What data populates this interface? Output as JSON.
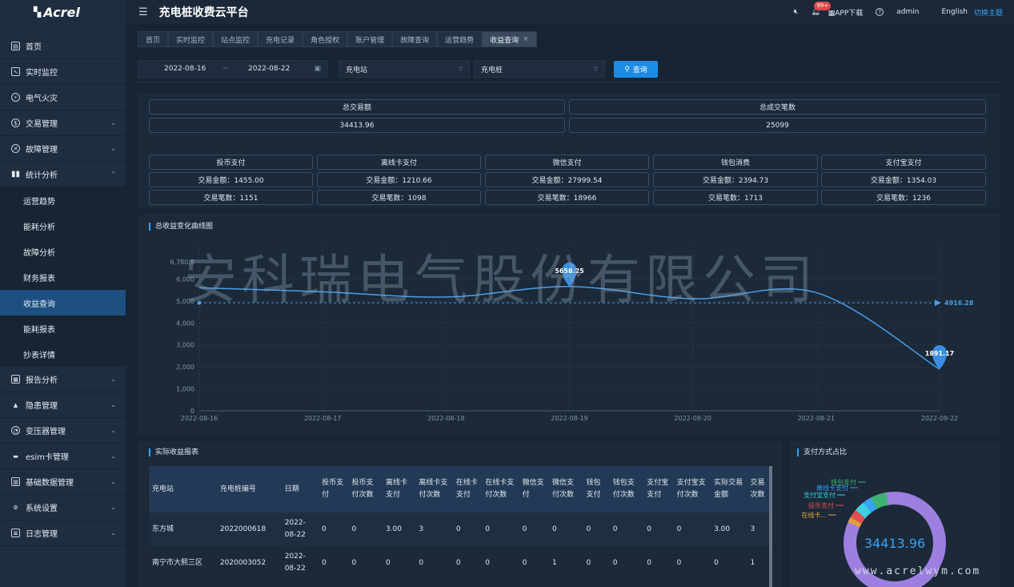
{
  "logo": {
    "text": "Acrel"
  },
  "header": {
    "title": "充电桩收费云平台",
    "badge": "99+",
    "app_download": "APP下载",
    "help": "?",
    "user": "admin",
    "language": "English",
    "theme": "切换主题"
  },
  "sidebar": {
    "items": [
      {
        "label": "首页"
      },
      {
        "label": "实时监控"
      },
      {
        "label": "电气火灾"
      },
      {
        "label": "交易管理"
      },
      {
        "label": "故障管理"
      },
      {
        "label": "统计分析"
      }
    ],
    "sub_items": [
      {
        "label": "运营趋势"
      },
      {
        "label": "能耗分析"
      },
      {
        "label": "故障分析"
      },
      {
        "label": "财务报表"
      },
      {
        "label": "收益查询"
      },
      {
        "label": "能耗报表"
      },
      {
        "label": "抄表详情"
      }
    ],
    "items_after": [
      {
        "label": "报告分析"
      },
      {
        "label": "隐患管理"
      },
      {
        "label": "变压器管理"
      },
      {
        "label": "esim卡管理"
      },
      {
        "label": "基础数据管理"
      },
      {
        "label": "系统设置"
      },
      {
        "label": "日志管理"
      }
    ]
  },
  "tabs": [
    {
      "label": "首页"
    },
    {
      "label": "实时监控"
    },
    {
      "label": "站点监控"
    },
    {
      "label": "充电记录"
    },
    {
      "label": "角色授权"
    },
    {
      "label": "账户管理"
    },
    {
      "label": "故障查询"
    },
    {
      "label": "运营趋势"
    },
    {
      "label": "收益查询"
    }
  ],
  "filters": {
    "start_date": "2022-08-16",
    "separator": "~",
    "end_date": "2022-08-22",
    "station_select": "充电站",
    "pile_select": "充电桩",
    "query_button": "查询"
  },
  "summary": {
    "total_amount_label": "总交易额",
    "total_amount_value": "34413.96",
    "total_count_label": "总成交笔数",
    "total_count_value": "25099"
  },
  "payments": [
    {
      "name": "投币支付",
      "amount": "交易金额：1455.00",
      "count": "交易笔数：1151"
    },
    {
      "name": "离线卡支付",
      "amount": "交易金额：1210.66",
      "count": "交易笔数：1098"
    },
    {
      "name": "微信支付",
      "amount": "交易金额：27999.54",
      "count": "交易笔数：18966"
    },
    {
      "name": "钱包消费",
      "amount": "交易金额：2394.73",
      "count": "交易笔数：1713"
    },
    {
      "name": "支付宝支付",
      "amount": "交易金额：1354.03",
      "count": "交易笔数：1236"
    }
  ],
  "watermark": "安科瑞电气股份有限公司",
  "chart_section_title": "总收益变化曲线图",
  "chart_data": {
    "type": "line",
    "x": [
      "2022-08-16",
      "2022-08-17",
      "2022-08-18",
      "2022-08-19",
      "2022-08-20",
      "2022-08-21",
      "2022-08-22"
    ],
    "y": [
      5600,
      5420,
      5180,
      5658.25,
      5100,
      5380,
      1891.17
    ],
    "ylim": [
      0,
      6780.8
    ],
    "yticks": [
      "0",
      "1,000",
      "2,000",
      "3,000",
      "4,000",
      "5,000",
      "6,000"
    ],
    "ymax_label": "6,780.8",
    "max_point": {
      "label": "5658.25"
    },
    "min_point": {
      "label": "1891.17"
    },
    "average": {
      "value": 4916.28,
      "label": "4916.28"
    },
    "line_color": "#4a9fe8",
    "grid": true
  },
  "table_section_title": "实际收益报表",
  "table": {
    "headers": [
      "充电站",
      "充电桩编号",
      "日期",
      "投币支付",
      "投币支付次数",
      "离线卡支付",
      "离线卡支付次数",
      "在线卡支付",
      "在线卡支付次数",
      "微信支付",
      "微信支付次数",
      "钱包支付",
      "钱包支付次数",
      "支付宝支付",
      "支付宝支付次数",
      "实际交易金额",
      "交易次数"
    ],
    "rows": [
      [
        "东方城",
        "2022000618",
        "2022-08-22",
        "0",
        "0",
        "3.00",
        "3",
        "0",
        "0",
        "0",
        "0",
        "0",
        "0",
        "0",
        "0",
        "3.00",
        "3"
      ],
      [
        "南宁市大熙三区",
        "2020003052",
        "2022-08-22",
        "0",
        "0",
        "0",
        "0",
        "0",
        "0",
        "0",
        "1",
        "0",
        "0",
        "0",
        "0",
        "0",
        "1"
      ]
    ]
  },
  "pie_section_title": "支付方式占比",
  "pie": {
    "center_label": "34413.96",
    "legend": [
      {
        "label": "钱包支付",
        "color": "#3cb371"
      },
      {
        "label": "离线卡支付",
        "color": "#36a3f7"
      },
      {
        "label": "支付宝支付",
        "color": "#3ad0e0"
      },
      {
        "label": "投币支付",
        "color": "#e05050"
      },
      {
        "label": "在线卡...",
        "color": "#e0a040"
      }
    ]
  },
  "footer_url": "www.acrelwym.com"
}
